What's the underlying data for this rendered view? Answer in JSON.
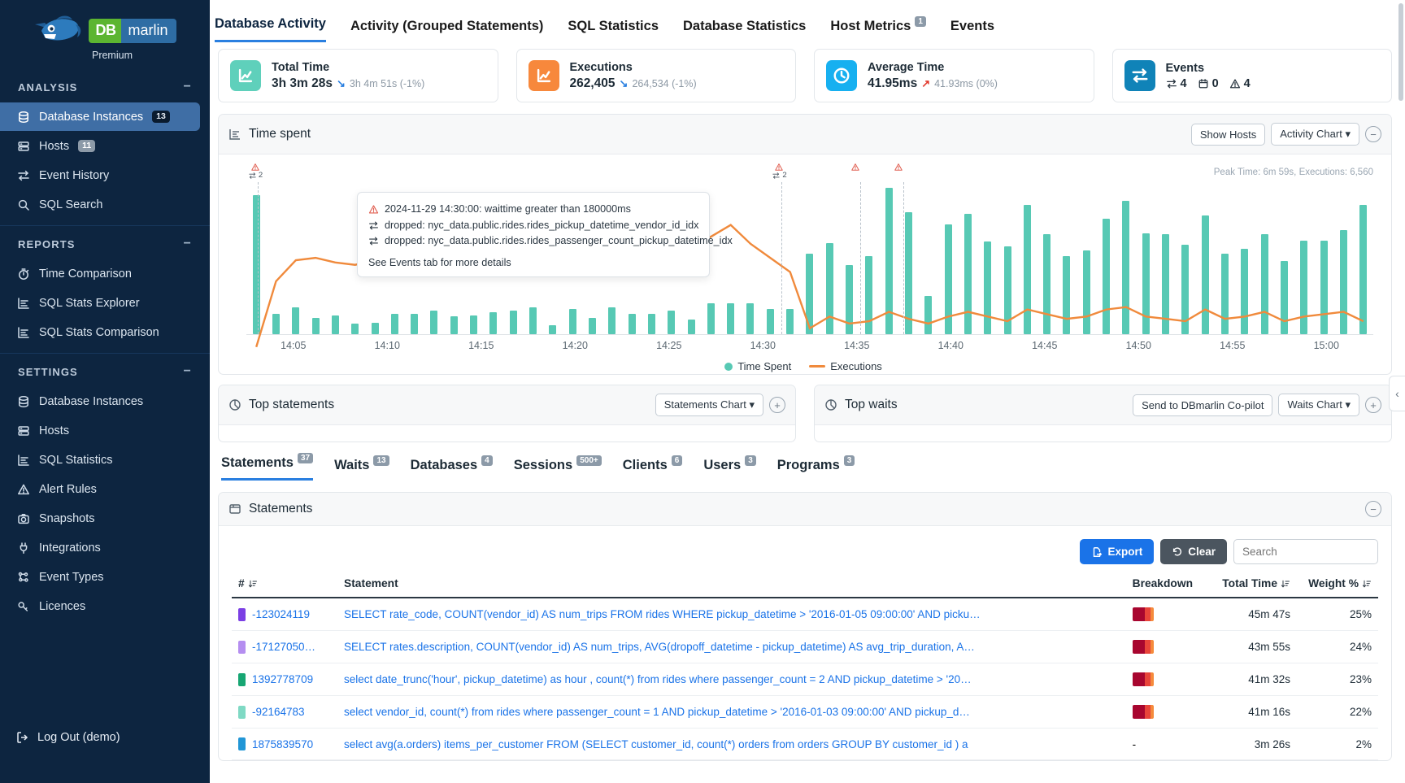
{
  "sidebar": {
    "logo": {
      "db": "DB",
      "marlin": "marlin",
      "tier": "Premium"
    },
    "sections": [
      {
        "title": "ANALYSIS",
        "items": [
          {
            "label": "Database Instances",
            "icon": "database-icon",
            "badge": "13",
            "active": true
          },
          {
            "label": "Hosts",
            "icon": "server-icon",
            "badge": "11",
            "active": false
          },
          {
            "label": "Event History",
            "icon": "swap-icon",
            "badge": "",
            "active": false
          },
          {
            "label": "SQL Search",
            "icon": "search-icon",
            "badge": "",
            "active": false
          }
        ]
      },
      {
        "title": "REPORTS",
        "items": [
          {
            "label": "Time Comparison",
            "icon": "stopwatch-icon",
            "badge": "",
            "active": false
          },
          {
            "label": "SQL Stats Explorer",
            "icon": "bar-chart-icon",
            "badge": "",
            "active": false
          },
          {
            "label": "SQL Stats Comparison",
            "icon": "bar-chart-icon",
            "badge": "",
            "active": false
          }
        ]
      },
      {
        "title": "SETTINGS",
        "items": [
          {
            "label": "Database Instances",
            "icon": "database-icon",
            "badge": "",
            "active": false
          },
          {
            "label": "Hosts",
            "icon": "server-icon",
            "badge": "",
            "active": false
          },
          {
            "label": "SQL Statistics",
            "icon": "bar-chart-icon",
            "badge": "",
            "active": false
          },
          {
            "label": "Alert Rules",
            "icon": "warning-icon",
            "badge": "",
            "active": false
          },
          {
            "label": "Snapshots",
            "icon": "camera-icon",
            "badge": "",
            "active": false
          },
          {
            "label": "Integrations",
            "icon": "plug-icon",
            "badge": "",
            "active": false
          },
          {
            "label": "Event Types",
            "icon": "event-types-icon",
            "badge": "",
            "active": false
          },
          {
            "label": "Licences",
            "icon": "key-icon",
            "badge": "",
            "active": false
          }
        ]
      }
    ],
    "logout": "Log Out (demo)"
  },
  "tabs": [
    {
      "label": "Database Activity",
      "badge": "",
      "active": true
    },
    {
      "label": "Activity (Grouped Statements)",
      "badge": "",
      "active": false
    },
    {
      "label": "SQL Statistics",
      "badge": "",
      "active": false
    },
    {
      "label": "Database Statistics",
      "badge": "",
      "active": false
    },
    {
      "label": "Host Metrics",
      "badge": "1",
      "active": false
    },
    {
      "label": "Events",
      "badge": "",
      "active": false
    }
  ],
  "kpis": [
    {
      "title": "Total Time",
      "value": "3h 3m 28s",
      "trend": "down",
      "compare": "3h 4m 51s (-1%)",
      "icon": "line-chart-icon",
      "color": "#5fd0bb"
    },
    {
      "title": "Executions",
      "value": "262,405",
      "trend": "down",
      "compare": "264,534 (-1%)",
      "icon": "line-chart-icon",
      "color": "#f7883c"
    },
    {
      "title": "Average Time",
      "value": "41.95ms",
      "trend": "up",
      "compare": "41.93ms (0%)",
      "icon": "clock-icon",
      "color": "#17b0f0"
    },
    {
      "title": "Events",
      "value": "",
      "trend": "",
      "compare": "",
      "icon": "swap-icon",
      "color": "#1083b8",
      "counts": [
        {
          "icon": "swap-icon",
          "value": "4"
        },
        {
          "icon": "calendar-icon",
          "value": "0"
        },
        {
          "icon": "warning-icon",
          "value": "4"
        }
      ]
    }
  ],
  "timespent": {
    "title": "Time spent",
    "show_hosts_label": "Show Hosts",
    "chart_select_label": "Activity Chart",
    "collapse_label": "⊖",
    "peak_label": "Peak Time: 6m 59s, Executions: 6,560"
  },
  "tooltip": {
    "lines": [
      {
        "icon": "warning-icon",
        "text": "2024-11-29 14:30:00: waittime greater than 180000ms"
      },
      {
        "icon": "swap-icon",
        "text": "dropped: nyc_data.public.rides.rides_pickup_datetime_vendor_id_idx"
      },
      {
        "icon": "swap-icon",
        "text": "dropped: nyc_data.public.rides.rides_passenger_count_pickup_datetime_idx"
      }
    ],
    "footer": "See Events tab for more details"
  },
  "event_markers": [
    {
      "x_pct": 1.0,
      "warn": true,
      "swap_count": "2"
    },
    {
      "x_pct": 47.5,
      "warn": true,
      "swap_count": "2"
    },
    {
      "x_pct": 54.5,
      "warn": true,
      "swap_count": ""
    },
    {
      "x_pct": 58.3,
      "warn": true,
      "swap_count": ""
    }
  ],
  "dual_panels": [
    {
      "title": "Top statements",
      "icon": "pie-chart-icon",
      "buttons": [
        {
          "label": "Statements Chart",
          "type": "select"
        }
      ],
      "plus": "⊕"
    },
    {
      "title": "Top waits",
      "icon": "pie-chart-icon",
      "buttons": [
        {
          "label": "Send to DBmarlin Co-pilot",
          "type": "button"
        },
        {
          "label": "Waits Chart",
          "type": "select"
        }
      ],
      "plus": "⊕"
    }
  ],
  "subtabs": [
    {
      "label": "Statements",
      "badge": "37",
      "active": true
    },
    {
      "label": "Waits",
      "badge": "13",
      "active": false
    },
    {
      "label": "Databases",
      "badge": "4",
      "active": false
    },
    {
      "label": "Sessions",
      "badge": "500+",
      "active": false
    },
    {
      "label": "Clients",
      "badge": "6",
      "active": false
    },
    {
      "label": "Users",
      "badge": "3",
      "active": false
    },
    {
      "label": "Programs",
      "badge": "3",
      "active": false
    }
  ],
  "statements_panel": {
    "title": "Statements",
    "icon": "statements-icon",
    "collapse": "⊖",
    "export_label": "Export",
    "clear_label": "Clear",
    "search_placeholder": "Search",
    "search_value": "",
    "columns": [
      "#",
      "Statement",
      "Breakdown",
      "Total Time",
      "Weight %"
    ],
    "rows": [
      {
        "swatch": "#7b3fe4",
        "id": "-123024119",
        "statement": "SELECT rate_code, COUNT(vendor_id) AS num_trips FROM rides WHERE pickup_datetime > '2016-01-05 09:00:00' AND picku…",
        "breakdown": [
          "#a8062f",
          "#e8443a",
          "#f58a3c"
        ],
        "total_time": "45m 47s",
        "weight": "25%"
      },
      {
        "swatch": "#b58ef0",
        "id": "-17127050…",
        "statement": "SELECT rates.description, COUNT(vendor_id) AS num_trips, AVG(dropoff_datetime - pickup_datetime) AS avg_trip_duration, A…",
        "breakdown": [
          "#a8062f",
          "#e8443a",
          "#f58a3c"
        ],
        "total_time": "43m 55s",
        "weight": "24%"
      },
      {
        "swatch": "#17a673",
        "id": "1392778709",
        "statement": "select date_trunc('hour', pickup_datetime) as hour , count(*) from rides where passenger_count = 2 AND pickup_datetime > '20…",
        "breakdown": [
          "#a8062f",
          "#e8443a",
          "#f58a3c"
        ],
        "total_time": "41m 32s",
        "weight": "23%"
      },
      {
        "swatch": "#7fd9c4",
        "id": "-92164783",
        "statement": "select vendor_id, count(*) from rides where passenger_count = 1 AND pickup_datetime > '2016-01-03 09:00:00' AND pickup_d…",
        "breakdown": [
          "#a8062f",
          "#e8443a",
          "#f58a3c"
        ],
        "total_time": "41m 16s",
        "weight": "22%"
      },
      {
        "swatch": "#2196d6",
        "id": "1875839570",
        "statement": "select avg(a.orders) items_per_customer FROM (SELECT customer_id, count(*) orders from orders GROUP BY customer_id ) a",
        "breakdown": [],
        "breakdown_dash": "-",
        "total_time": "3m 26s",
        "weight": "2%"
      }
    ]
  },
  "chart_data": {
    "type": "bar",
    "title": "Time spent",
    "xlabel": "",
    "ylabel": "",
    "grid": false,
    "legend_position": "bottom",
    "x_ticks": [
      "14:05",
      "14:10",
      "14:15",
      "14:20",
      "14:25",
      "14:30",
      "14:35",
      "14:40",
      "14:45",
      "14:50",
      "14:55",
      "15:00"
    ],
    "series": [
      {
        "name": "Time Spent",
        "type": "bar",
        "color": "#57c9b4",
        "values": [
          95,
          14,
          18,
          11,
          13,
          7,
          8,
          14,
          14,
          16,
          12,
          13,
          15,
          16,
          18,
          6,
          17,
          11,
          18,
          14,
          14,
          16,
          10,
          21,
          21,
          21,
          17,
          17,
          55,
          62,
          47,
          53,
          100,
          83,
          26,
          75,
          82,
          63,
          60,
          88,
          68,
          53,
          57,
          79,
          91,
          69,
          68,
          61,
          81,
          55,
          58,
          68,
          50,
          64,
          64,
          71,
          88
        ]
      },
      {
        "name": "Executions",
        "type": "line",
        "color": "#f08a3c",
        "values": [
          20,
          48,
          57,
          58,
          56,
          55,
          57,
          62,
          60,
          66,
          64,
          62,
          66,
          64,
          62,
          65,
          68,
          64,
          66,
          70,
          68,
          66,
          62,
          67,
          72,
          64,
          58,
          52,
          28,
          33,
          30,
          31,
          35,
          32,
          30,
          33,
          35,
          33,
          31,
          36,
          34,
          32,
          33,
          36,
          37,
          33,
          32,
          31,
          36,
          32,
          33,
          35,
          31,
          33,
          34,
          35,
          31
        ]
      }
    ],
    "peak_annotation": "Peak Time: 6m 59s, Executions: 6,560"
  }
}
